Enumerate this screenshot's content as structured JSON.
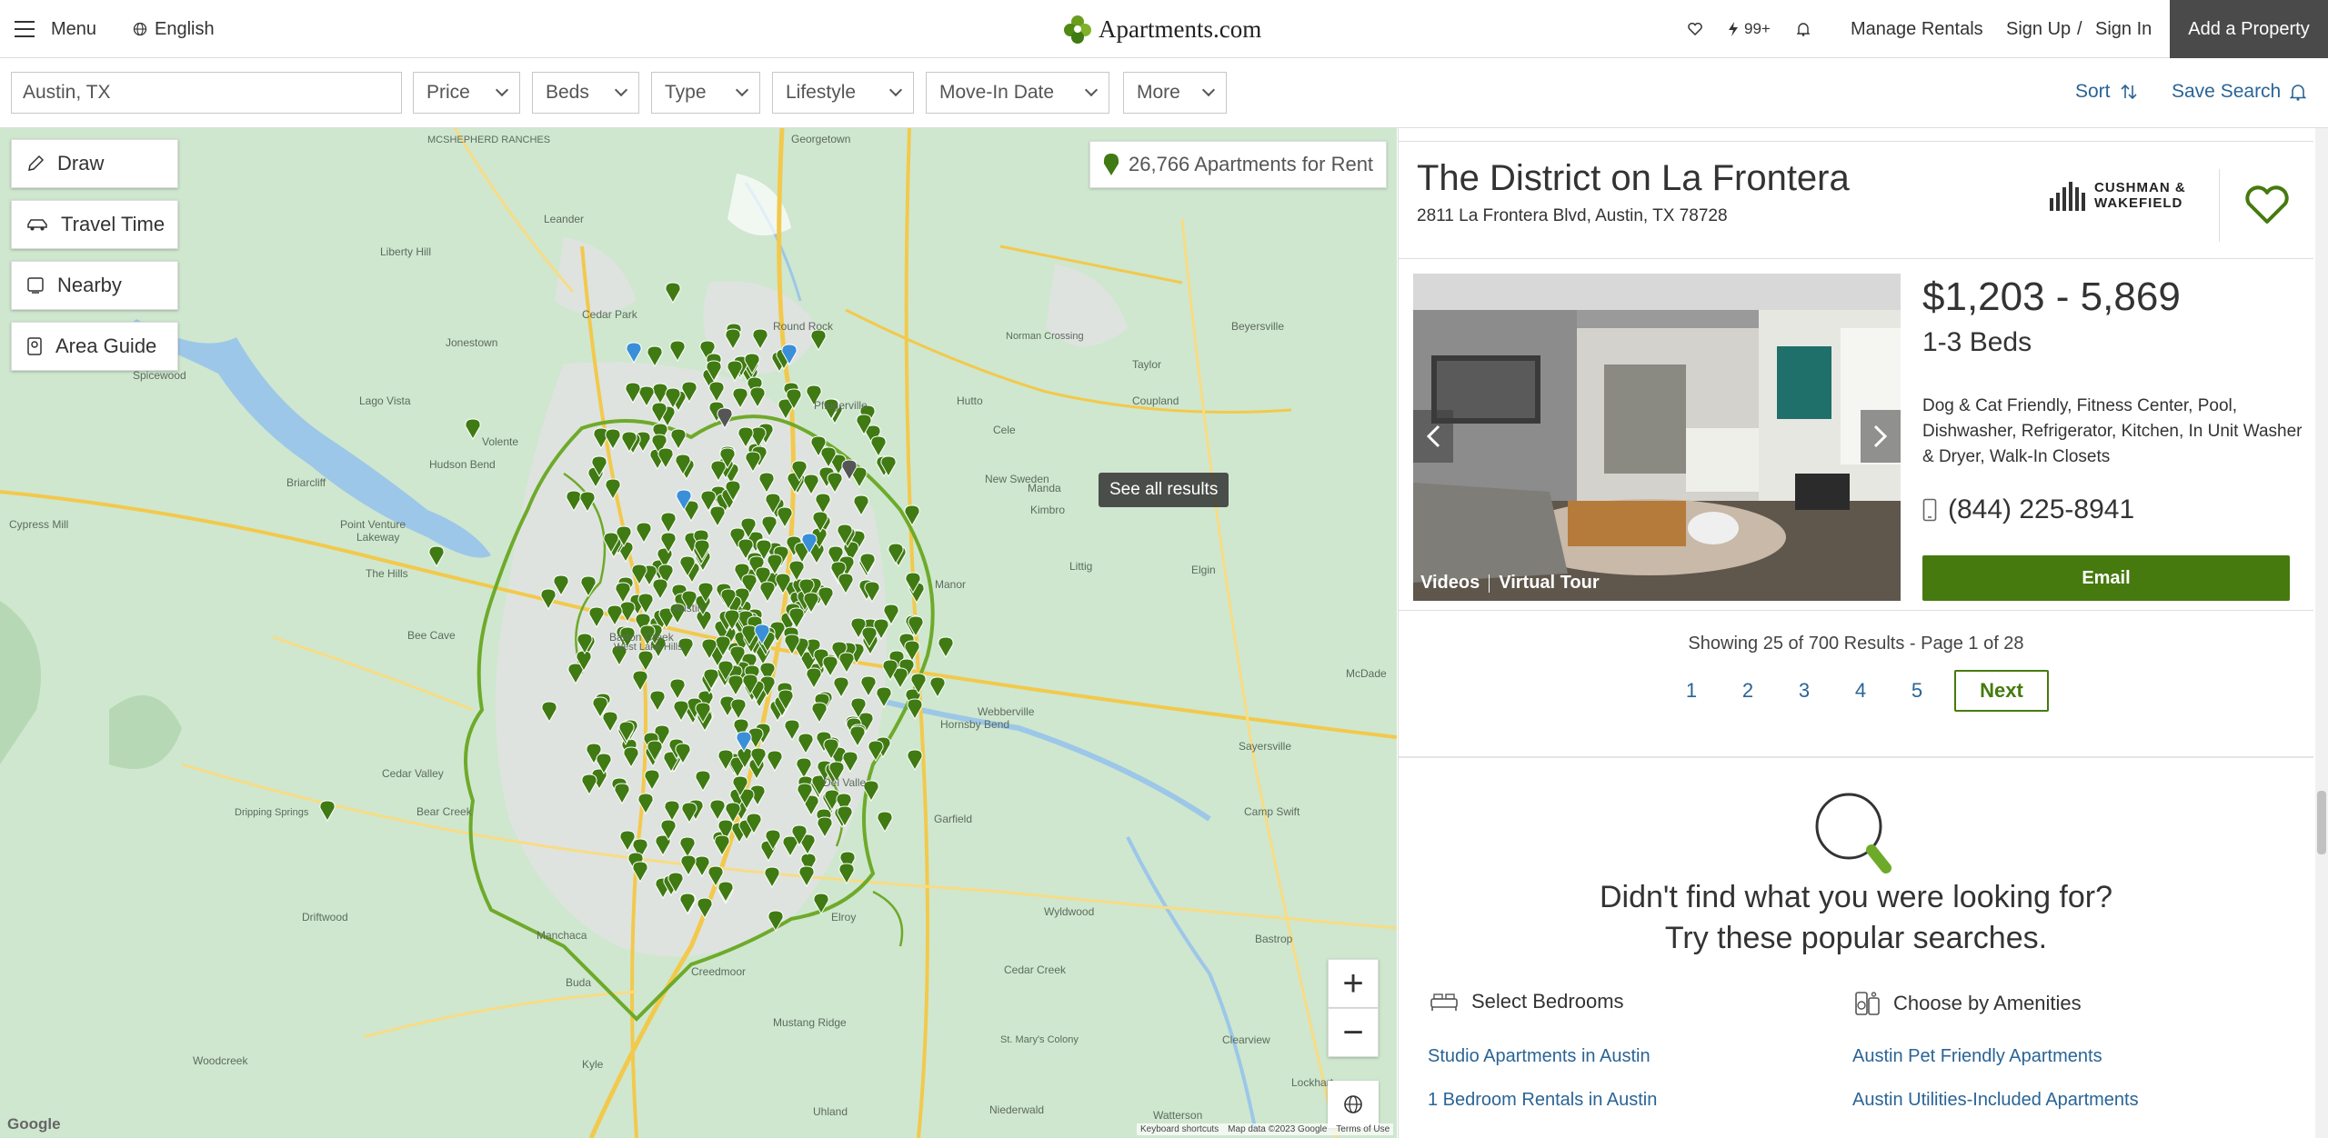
{
  "nav": {
    "menu_label": "Menu",
    "language_label": "English",
    "logo_text": "Apartments.com",
    "notification_count": "99+",
    "manage_rentals": "Manage Rentals",
    "sign_up": "Sign Up",
    "separator": "/",
    "sign_in": "Sign In",
    "add_property": "Add a Property"
  },
  "filters": {
    "location_value": "Austin, TX",
    "buttons": [
      "Price",
      "Beds",
      "Type",
      "Lifestyle",
      "Move-In Date",
      "More"
    ],
    "sort_label": "Sort",
    "save_search_label": "Save Search"
  },
  "map": {
    "tools": [
      "Draw",
      "Travel Time",
      "Nearby",
      "Area Guide"
    ],
    "result_count": "26,766 Apartments for Rent",
    "see_all_tooltip": "See all results",
    "zoom_in": "+",
    "zoom_out": "−",
    "google_logo": "Google",
    "credits": [
      "Keyboard shortcuts",
      "Map data ©2023 Google",
      "Terms of Use"
    ],
    "labels": [
      {
        "text": "MCSHEPHERD RANCHES"
      },
      {
        "text": "Georgetown"
      },
      {
        "text": "Leander"
      },
      {
        "text": "Liberty Hill"
      },
      {
        "text": "Jonestown"
      },
      {
        "text": "Lago Vista"
      },
      {
        "text": "Round Rock"
      },
      {
        "text": "Hutto"
      },
      {
        "text": "Taylor"
      },
      {
        "text": "Pflugerville"
      },
      {
        "text": "Coupland"
      },
      {
        "text": "Briarcliff"
      },
      {
        "text": "Cypress Mill"
      },
      {
        "text": "Lakeway"
      },
      {
        "text": "Bee Cave"
      },
      {
        "text": "Manor"
      },
      {
        "text": "Elgin"
      },
      {
        "text": "Webberville"
      },
      {
        "text": "Garfield"
      },
      {
        "text": "Buda"
      },
      {
        "text": "Kyle"
      },
      {
        "text": "Creedmoor"
      },
      {
        "text": "Manchaca"
      },
      {
        "text": "Dripping Springs"
      },
      {
        "text": "Driftwood"
      },
      {
        "text": "Cedar Valley"
      },
      {
        "text": "Bastrop"
      },
      {
        "text": "Cedar Creek"
      },
      {
        "text": "Mustang Ridge"
      },
      {
        "text": "Lockhart"
      },
      {
        "text": "Manda"
      },
      {
        "text": "Littig"
      },
      {
        "text": "Kimbro"
      },
      {
        "text": "Hornsby Bend"
      },
      {
        "text": "Del Valle"
      },
      {
        "text": "Elroy"
      },
      {
        "text": "Wyldwood"
      },
      {
        "text": "Camp Swift"
      },
      {
        "text": "Sayersville"
      },
      {
        "text": "McDade"
      },
      {
        "text": "Cedar Park"
      },
      {
        "text": "Volente"
      },
      {
        "text": "Hudson Bend"
      },
      {
        "text": "Point Venture"
      },
      {
        "text": "The Hills"
      },
      {
        "text": "Beyersville"
      },
      {
        "text": "Norman Crossing"
      },
      {
        "text": "New Sweden"
      },
      {
        "text": "Cele"
      },
      {
        "text": "Spicewood"
      },
      {
        "text": "Bear Creek"
      },
      {
        "text": "Woodcreek"
      },
      {
        "text": "Uhland"
      },
      {
        "text": "Niederwald"
      },
      {
        "text": "Clearview"
      },
      {
        "text": "St. Mary's Colony"
      },
      {
        "text": "Watterson"
      },
      {
        "text": "Austin"
      },
      {
        "text": "Barton Creek"
      },
      {
        "text": "West Lake Hills"
      }
    ]
  },
  "listing": {
    "title": "The District on La Frontera",
    "address": "2811 La Frontera Blvd, Austin, TX 78728",
    "mgmt_line1": "CUSHMAN &",
    "mgmt_line2": "WAKEFIELD",
    "price": "$1,203 - 5,869",
    "beds": "1-3 Beds",
    "amenities": "Dog & Cat Friendly, Fitness Center, Pool, Dishwasher, Refrigerator, Kitchen, In Unit Washer & Dryer, Walk-In Closets",
    "phone": "(844) 225-8941",
    "email_label": "Email",
    "photo_tag_videos": "Videos",
    "photo_tag_tour": "Virtual Tour"
  },
  "results": {
    "info": "Showing 25 of 700 Results - Page 1 of 28",
    "pages": [
      "1",
      "2",
      "3",
      "4",
      "5"
    ],
    "next_label": "Next"
  },
  "popular": {
    "heading_line1": "Didn't find what you were looking for?",
    "heading_line2": "Try these popular searches.",
    "bedrooms_heading": "Select Bedrooms",
    "amenities_heading": "Choose by Amenities",
    "bedroom_links": [
      "Studio Apartments in Austin",
      "1 Bedroom Rentals in Austin"
    ],
    "amenity_links": [
      "Austin Pet Friendly Apartments",
      "Austin Utilities-Included Apartments"
    ]
  },
  "colors": {
    "brand_green": "#467a0e",
    "link_blue": "#2a6496",
    "pin_green": "#3f7a12",
    "pin_blue": "#3a8fd8",
    "add_property_bg": "#4a4a4a"
  }
}
